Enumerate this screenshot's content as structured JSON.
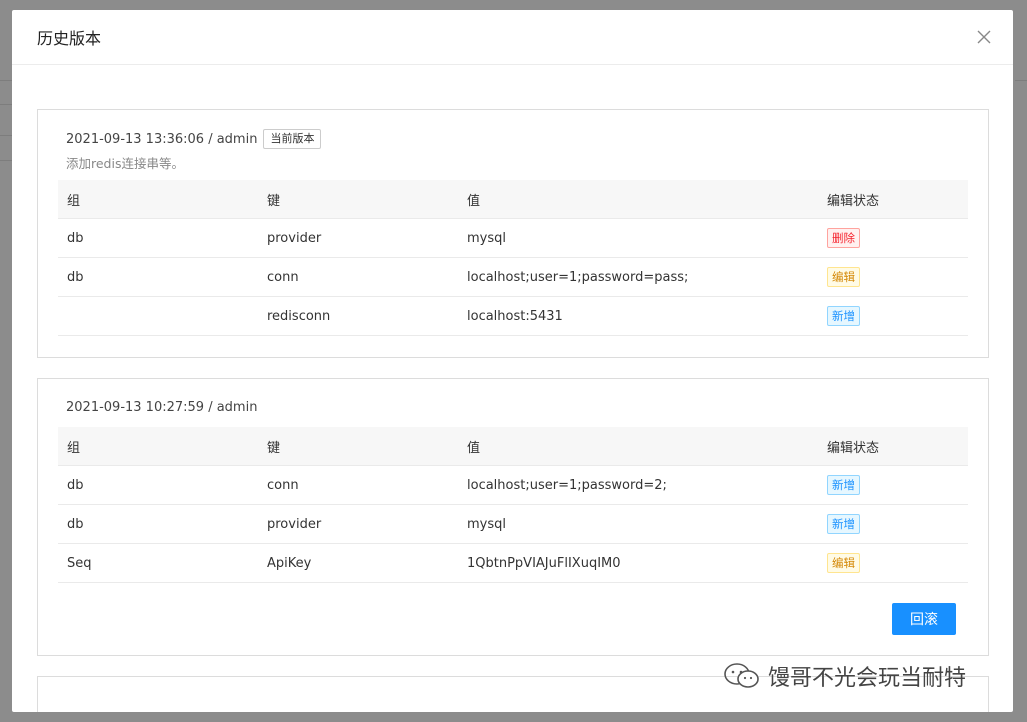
{
  "dialog": {
    "title": "历史版本",
    "close_symbol": "×"
  },
  "versions": [
    {
      "meta": "2021-09-13 13:36:06 / admin",
      "current_tag": "当前版本",
      "remark": "添加redis连接串等。",
      "headers": [
        "组",
        "键",
        "值",
        "编辑状态"
      ],
      "rows": [
        {
          "group": "db",
          "key": "provider",
          "value": "mysql",
          "status": "删除"
        },
        {
          "group": "db",
          "key": "conn",
          "value": "localhost;user=1;password=pass;",
          "status": "编辑"
        },
        {
          "group": "",
          "key": "redisconn",
          "value": "localhost:5431",
          "status": "新增"
        }
      ]
    },
    {
      "meta": "2021-09-13 10:27:59 / admin",
      "headers": [
        "组",
        "键",
        "值",
        "编辑状态"
      ],
      "rows": [
        {
          "group": "db",
          "key": "conn",
          "value": "localhost;user=1;password=2;",
          "status": "新增"
        },
        {
          "group": "db",
          "key": "provider",
          "value": "mysql",
          "status": "新增"
        },
        {
          "group": "Seq",
          "key": "ApiKey",
          "value": "1QbtnPpVIAJuFlIXuqIM0",
          "status": "编辑"
        }
      ],
      "rollback_label": "回滚"
    }
  ],
  "status_colors": {
    "删除": "#f5222d",
    "编辑": "#d48806",
    "新增": "#1890ff"
  },
  "watermark": {
    "text": "馒哥不光会玩当耐特",
    "icon": "wechat-icon"
  }
}
